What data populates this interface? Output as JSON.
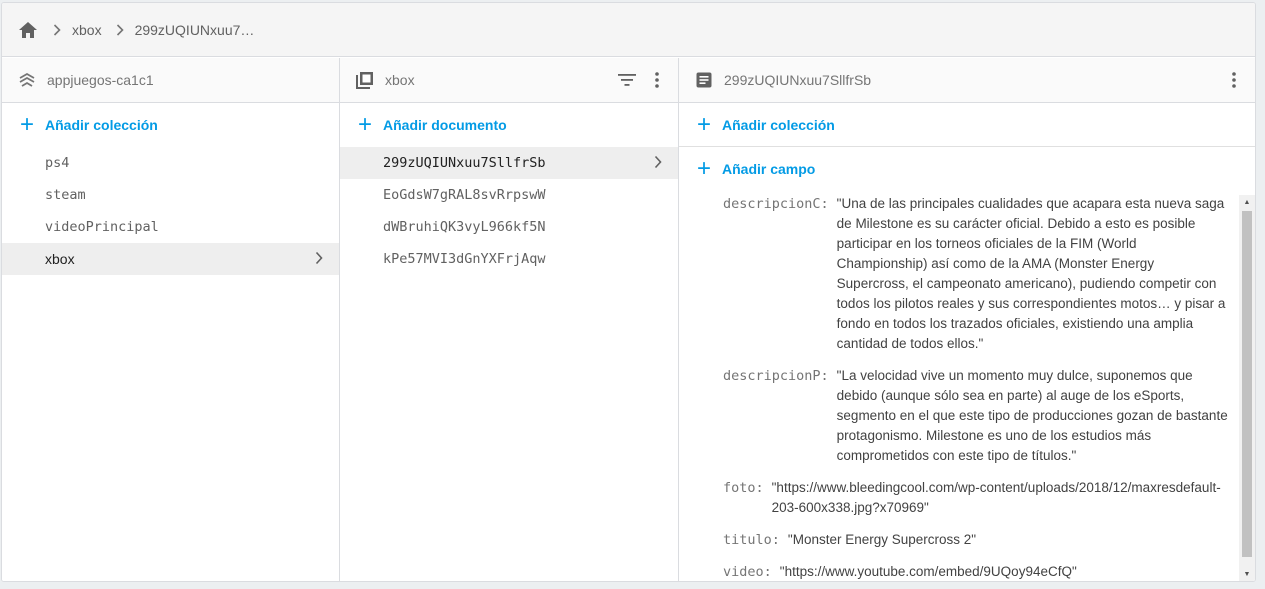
{
  "breadcrumb": {
    "items": [
      "xbox",
      "299zUQIUNxuu7…"
    ]
  },
  "col1": {
    "header": "appjuegos-ca1c1",
    "add_label": "Añadir colección",
    "items": [
      "ps4",
      "steam",
      "videoPrincipal",
      "xbox"
    ]
  },
  "col2": {
    "header": "xbox",
    "add_label": "Añadir documento",
    "items": [
      "299zUQIUNxuu7SllfrSb",
      "EoGdsW7gRAL8svRrpswW",
      "dWBruhiQK3vyL966kf5N",
      "kPe57MVI3dGnYXFrjAqw"
    ]
  },
  "col3": {
    "header": "299zUQIUNxuu7SllfrSb",
    "add_collection_label": "Añadir colección",
    "add_field_label": "Añadir campo",
    "fields": [
      {
        "key": "descripcionC:",
        "value": "\"Una de las principales cualidades que acapara esta nueva saga de Milestone es su carácter oficial. Debido a esto es posible participar en los torneos oficiales de la FIM (World Championship) así como de la AMA (Monster Energy Supercross, el campeonato americano), pudiendo competir con todos los pilotos reales y sus correspondientes motos… y pisar a fondo en todos los trazados oficiales, existiendo una amplia cantidad de todos ellos.\""
      },
      {
        "key": "descripcionP:",
        "value": "\"La velocidad vive un momento muy dulce, suponemos que debido (aunque sólo sea en parte) al auge de los eSports, segmento en el que este tipo de producciones gozan de bastante protagonismo. Milestone es uno de los estudios más comprometidos con este tipo de títulos.\""
      },
      {
        "key": "foto:",
        "value": "\"https://www.bleedingcool.com/wp-content/uploads/2018/12/maxresdefault-203-600x338.jpg?x70969\""
      },
      {
        "key": "titulo:",
        "value": "\"Monster Energy Supercross 2\""
      },
      {
        "key": "video:",
        "value": "\"https://www.youtube.com/embed/9UQoy94eCfQ\""
      }
    ]
  },
  "colors": {
    "accent": "#039be5",
    "selected_bg": "#eeeeee"
  }
}
